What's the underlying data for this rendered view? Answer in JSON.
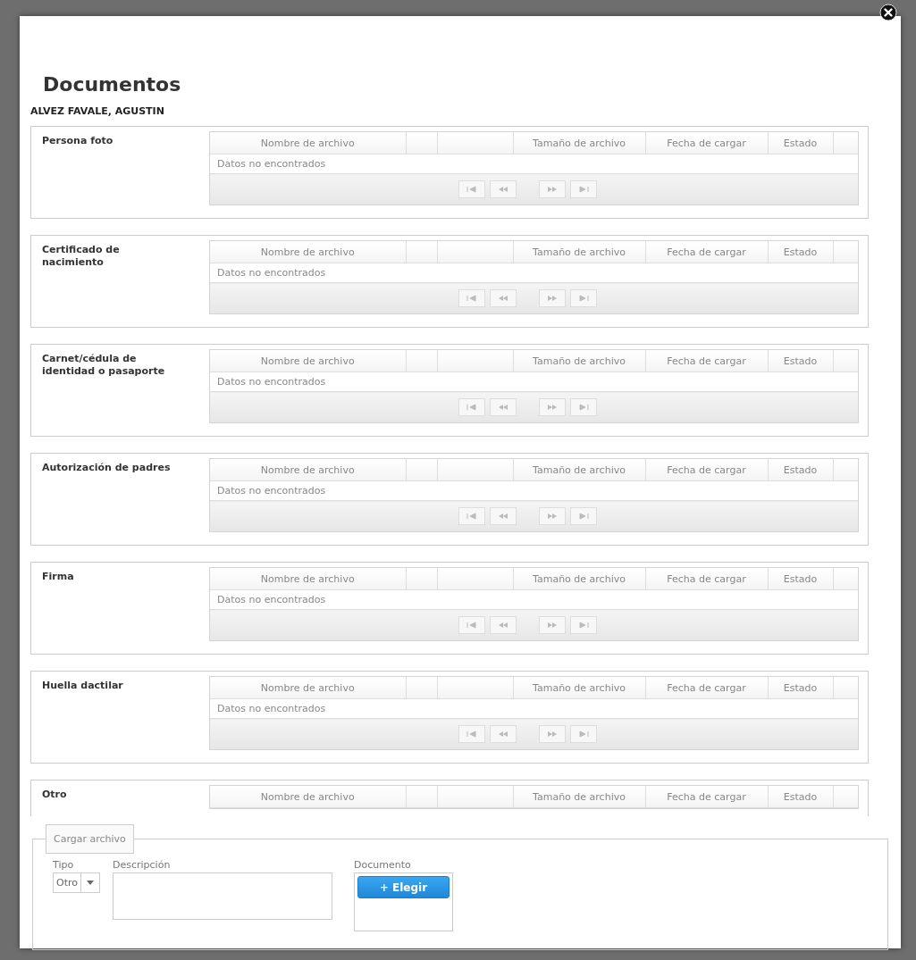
{
  "dialog": {
    "title": "Documentos",
    "subtitle": "ALVEZ FAVALE, AGUSTIN"
  },
  "sections": [
    {
      "label": "Persona foto",
      "columns": [
        {
          "kind": "text",
          "label": "Nombre de archivo"
        },
        {
          "kind": "blank"
        },
        {
          "kind": "blank"
        },
        {
          "kind": "text",
          "label": "Tamaño de archivo"
        },
        {
          "kind": "text",
          "label": "Fecha de cargar"
        },
        {
          "kind": "text",
          "label": "Estado"
        },
        {
          "kind": "blank"
        }
      ],
      "empty_message": "Datos no encontrados",
      "pager": true
    },
    {
      "label": "Certificado de nacimiento",
      "columns": [
        {
          "kind": "text",
          "label": "Nombre de archivo"
        },
        {
          "kind": "blank"
        },
        {
          "kind": "blank"
        },
        {
          "kind": "text",
          "label": "Tamaño de archivo"
        },
        {
          "kind": "text",
          "label": "Fecha de cargar"
        },
        {
          "kind": "text",
          "label": "Estado"
        },
        {
          "kind": "blank"
        }
      ],
      "empty_message": "Datos no encontrados",
      "pager": true
    },
    {
      "label": "Carnet/cédula de identidad o pasaporte",
      "columns": [
        {
          "kind": "text",
          "label": "Nombre de archivo"
        },
        {
          "kind": "blank"
        },
        {
          "kind": "blank"
        },
        {
          "kind": "text",
          "label": "Tamaño de archivo"
        },
        {
          "kind": "text",
          "label": "Fecha de cargar"
        },
        {
          "kind": "text",
          "label": "Estado"
        },
        {
          "kind": "blank"
        }
      ],
      "empty_message": "Datos no encontrados",
      "pager": true
    },
    {
      "label": "Autorización de padres",
      "columns": [
        {
          "kind": "text",
          "label": "Nombre de archivo"
        },
        {
          "kind": "blank"
        },
        {
          "kind": "blank"
        },
        {
          "kind": "text",
          "label": "Tamaño de archivo"
        },
        {
          "kind": "text",
          "label": "Fecha de cargar"
        },
        {
          "kind": "text",
          "label": "Estado"
        },
        {
          "kind": "blank"
        }
      ],
      "empty_message": "Datos no encontrados",
      "pager": true
    },
    {
      "label": "Firma",
      "columns": [
        {
          "kind": "text",
          "label": "Nombre de archivo"
        },
        {
          "kind": "blank"
        },
        {
          "kind": "blank"
        },
        {
          "kind": "text",
          "label": "Tamaño de archivo"
        },
        {
          "kind": "text",
          "label": "Fecha de cargar"
        },
        {
          "kind": "text",
          "label": "Estado"
        },
        {
          "kind": "blank"
        }
      ],
      "empty_message": "Datos no encontrados",
      "pager": true
    },
    {
      "label": "Huella dactilar",
      "columns": [
        {
          "kind": "text",
          "label": "Nombre de archivo"
        },
        {
          "kind": "blank"
        },
        {
          "kind": "blank"
        },
        {
          "kind": "text",
          "label": "Tamaño de archivo"
        },
        {
          "kind": "text",
          "label": "Fecha de cargar"
        },
        {
          "kind": "text",
          "label": "Estado"
        },
        {
          "kind": "blank"
        }
      ],
      "empty_message": "Datos no encontrados",
      "pager": true
    },
    {
      "label": "Otro",
      "columns": [
        {
          "kind": "text",
          "label": "Nombre de archivo"
        },
        {
          "kind": "blank"
        },
        {
          "kind": "blank"
        },
        {
          "kind": "text",
          "label": "Tamaño de archivo"
        },
        {
          "kind": "text",
          "label": "Fecha de cargar"
        },
        {
          "kind": "text",
          "label": "Estado"
        },
        {
          "kind": "blank"
        }
      ],
      "pager": false
    }
  ],
  "upload": {
    "legend": "Cargar archivo",
    "type_label": "Tipo",
    "type_value": "Otro",
    "description_label": "Descripción",
    "document_label": "Documento",
    "choose_button": "+ Elegir"
  }
}
